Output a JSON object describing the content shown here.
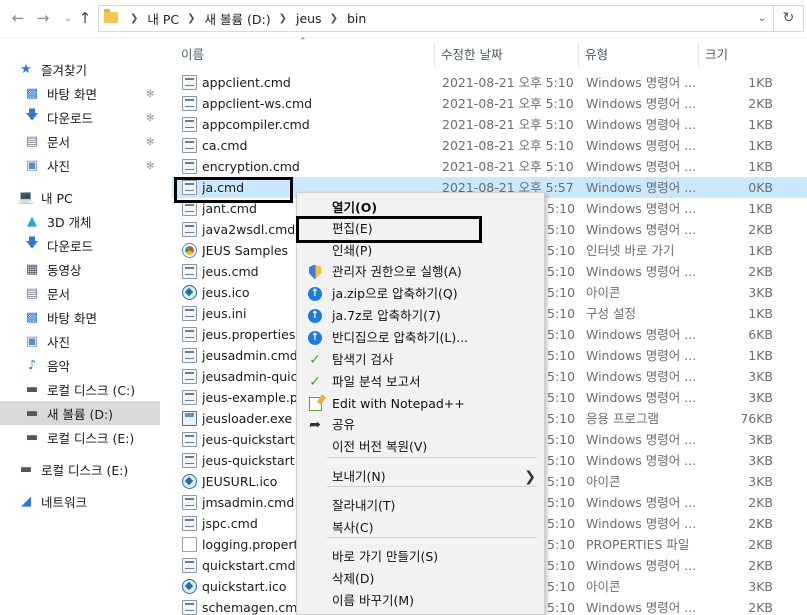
{
  "address_bar": {
    "breadcrumbs": [
      "내 PC",
      "새 볼륨 (D:)",
      "jeus",
      "bin"
    ]
  },
  "nav_icons": [
    "back-arrow-icon",
    "forward-arrow-icon",
    "recent-dropdown-icon",
    "up-arrow-icon"
  ],
  "sidebar": {
    "quick_access": {
      "label": "즐겨찾기",
      "items": [
        {
          "label": "바탕 화면",
          "icon": "desktop-icon",
          "pinned": true
        },
        {
          "label": "다운로드",
          "icon": "download-icon",
          "pinned": true
        },
        {
          "label": "문서",
          "icon": "documents-icon",
          "pinned": true
        },
        {
          "label": "사진",
          "icon": "pictures-icon",
          "pinned": true
        }
      ]
    },
    "this_pc": {
      "label": "내 PC",
      "items": [
        {
          "label": "3D 개체",
          "icon": "3d-objects-icon"
        },
        {
          "label": "다운로드",
          "icon": "download-icon"
        },
        {
          "label": "동영상",
          "icon": "videos-icon"
        },
        {
          "label": "문서",
          "icon": "documents-icon"
        },
        {
          "label": "바탕 화면",
          "icon": "desktop-icon"
        },
        {
          "label": "사진",
          "icon": "pictures-icon"
        },
        {
          "label": "음악",
          "icon": "music-icon"
        },
        {
          "label": "로컬 디스크 (C:)",
          "icon": "drive-icon"
        },
        {
          "label": "새 볼륨 (D:)",
          "icon": "drive-icon",
          "selected": true
        },
        {
          "label": "로컬 디스크 (E:)",
          "icon": "drive-icon"
        }
      ]
    },
    "extra_drive": {
      "label": "로컬 디스크 (E:)",
      "icon": "drive-icon"
    },
    "network": {
      "label": "네트워크",
      "icon": "network-icon"
    }
  },
  "columns": {
    "name": "이름",
    "date": "수정한 날짜",
    "type": "유형",
    "size": "크기"
  },
  "files": [
    {
      "name": "appclient.cmd",
      "date": "2021-08-21 오후 5:10",
      "type": "Windows 명령어 ...",
      "size": "1KB",
      "kind": "cmd"
    },
    {
      "name": "appclient-ws.cmd",
      "date": "2021-08-21 오후 5:10",
      "type": "Windows 명령어 ...",
      "size": "2KB",
      "kind": "cmd"
    },
    {
      "name": "appcompiler.cmd",
      "date": "2021-08-21 오후 5:10",
      "type": "Windows 명령어 ...",
      "size": "1KB",
      "kind": "cmd"
    },
    {
      "name": "ca.cmd",
      "date": "2021-08-21 오후 5:10",
      "type": "Windows 명령어 ...",
      "size": "1KB",
      "kind": "cmd"
    },
    {
      "name": "encryption.cmd",
      "date": "2021-08-21 오후 5:10",
      "type": "Windows 명령어 ...",
      "size": "1KB",
      "kind": "cmd"
    },
    {
      "name": "ja.cmd",
      "date": "2021-08-21 오후 5:57",
      "type": "Windows 명령어 ...",
      "size": "0KB",
      "kind": "cmd",
      "selected": true
    },
    {
      "name": "jant.cmd",
      "date": "5:10",
      "type": "Windows 명령어 ...",
      "size": "1KB",
      "kind": "cmd"
    },
    {
      "name": "java2wsdl.cmd",
      "date": "5:10",
      "type": "Windows 명령어 ...",
      "size": "2KB",
      "kind": "cmd"
    },
    {
      "name": "JEUS Samples",
      "date": "5:10",
      "type": "인터넷 바로 가기",
      "size": "1KB",
      "kind": "url"
    },
    {
      "name": "jeus.cmd",
      "date": "5:10",
      "type": "Windows 명령어 ...",
      "size": "2KB",
      "kind": "cmd"
    },
    {
      "name": "jeus.ico",
      "date": "5:10",
      "type": "아이콘",
      "size": "3KB",
      "kind": "ico"
    },
    {
      "name": "jeus.ini",
      "date": "5:10",
      "type": "구성 설정",
      "size": "1KB",
      "kind": "ini"
    },
    {
      "name": "jeus.properties.cm",
      "date": "5:10",
      "type": "Windows 명령어 ...",
      "size": "6KB",
      "kind": "cmd"
    },
    {
      "name": "jeusadmin.cmd",
      "date": "5:10",
      "type": "Windows 명령어 ...",
      "size": "1KB",
      "kind": "cmd"
    },
    {
      "name": "jeusadmin-quicks",
      "date": "5:10",
      "type": "Windows 명령어 ...",
      "size": "3KB",
      "kind": "cmd"
    },
    {
      "name": "jeus-example.prop",
      "date": "5:10",
      "type": "Windows 명령어 ...",
      "size": "3KB",
      "kind": "cmd"
    },
    {
      "name": "jeusloader.exe",
      "date": "5:10",
      "type": "응용 프로그램",
      "size": "76KB",
      "kind": "exe"
    },
    {
      "name": "jeus-quickstart.cm",
      "date": "5:10",
      "type": "Windows 명령어 ...",
      "size": "3KB",
      "kind": "cmd"
    },
    {
      "name": "jeus-quickstart.pro",
      "date": "5:10",
      "type": "Windows 명령어 ...",
      "size": "3KB",
      "kind": "cmd"
    },
    {
      "name": "JEUSURL.ico",
      "date": "5:10",
      "type": "아이콘",
      "size": "3KB",
      "kind": "ico"
    },
    {
      "name": "jmsadmin.cmd",
      "date": "5:10",
      "type": "Windows 명령어 ...",
      "size": "2KB",
      "kind": "cmd"
    },
    {
      "name": "jspc.cmd",
      "date": "5:10",
      "type": "Windows 명령어 ...",
      "size": "2KB",
      "kind": "cmd"
    },
    {
      "name": "logging.properties",
      "date": "5:10",
      "type": "PROPERTIES 파일",
      "size": "2KB",
      "kind": "prop"
    },
    {
      "name": "quickstart.cmd",
      "date": "5:10",
      "type": "Windows 명령어 ...",
      "size": "2KB",
      "kind": "cmd"
    },
    {
      "name": "quickstart.ico",
      "date": "5:10",
      "type": "아이콘",
      "size": "3KB",
      "kind": "ico"
    },
    {
      "name": "schemagen.cmd",
      "date": "5:10",
      "type": "Windows 명령어 ...",
      "size": "2KB",
      "kind": "cmd"
    }
  ],
  "context_menu": {
    "items": [
      {
        "label": "열기(O)",
        "bold": true
      },
      {
        "label": "편집(E)"
      },
      {
        "label": "인쇄(P)"
      },
      {
        "label": "관리자 권한으로 실행(A)",
        "icon": "uac-shield-icon"
      },
      {
        "label": "ja.zip으로 압축하기(Q)",
        "icon": "bandizip-icon"
      },
      {
        "label": "ja.7z로 압축하기(7)",
        "icon": "bandizip-icon"
      },
      {
        "label": "반디집으로 압축하기(L)...",
        "icon": "bandizip-icon"
      },
      {
        "label": "탐색기 검사",
        "icon": "v3-scan-icon"
      },
      {
        "label": "파일 분석 보고서",
        "icon": "v3-report-icon"
      },
      {
        "label": "Edit with Notepad++",
        "icon": "notepad-plus-plus-icon"
      },
      {
        "label": "공유",
        "icon": "share-icon"
      },
      {
        "label": "이전 버전 복원(V)"
      },
      {
        "label": "보내기(N)",
        "submenu": true
      },
      {
        "label": "잘라내기(T)"
      },
      {
        "label": "복사(C)"
      },
      {
        "label": "바로 가기 만들기(S)"
      },
      {
        "label": "삭제(D)"
      },
      {
        "label": "이름 바꾸기(M)"
      }
    ]
  }
}
